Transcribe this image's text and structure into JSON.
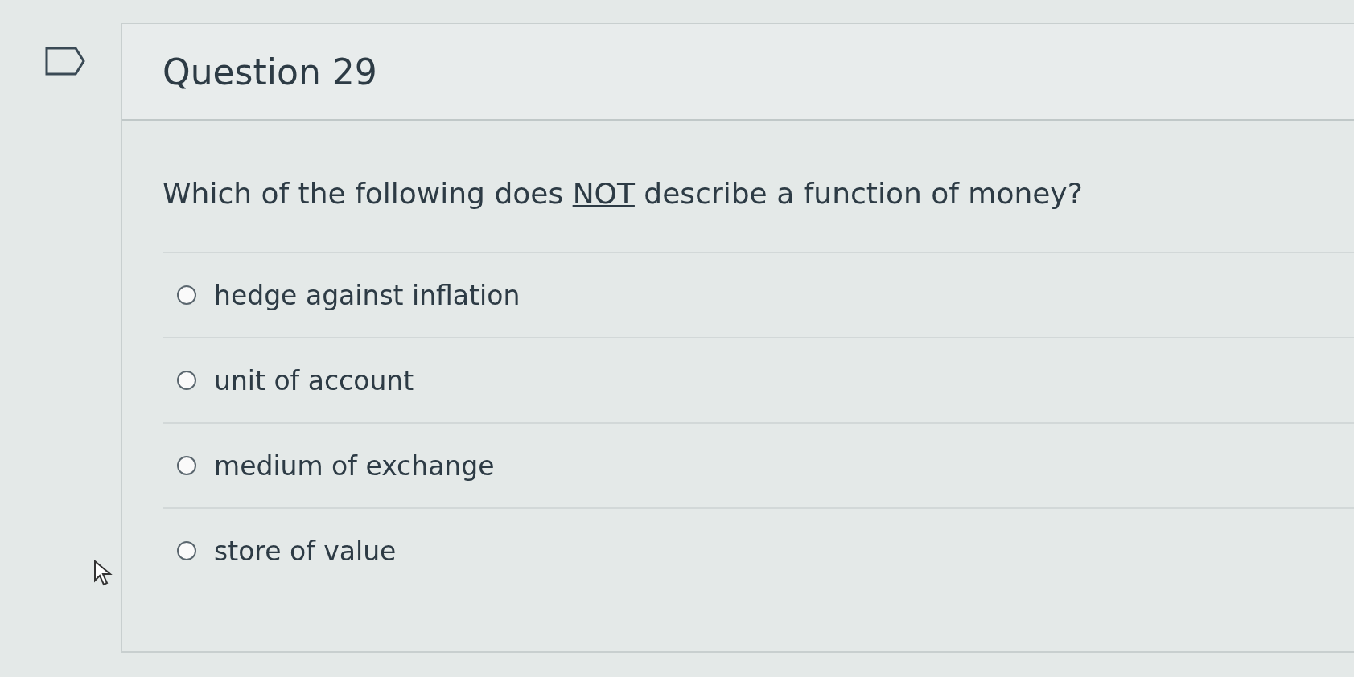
{
  "question": {
    "title": "Question 29",
    "flagged": false
  },
  "prompt": {
    "before": "Which of the following does ",
    "underlined": "NOT",
    "after": " describe a function of money?"
  },
  "options": [
    {
      "label": "hedge against inflation",
      "selected": false
    },
    {
      "label": "unit of account",
      "selected": false
    },
    {
      "label": "medium of exchange",
      "selected": false
    },
    {
      "label": "store of value",
      "selected": false
    }
  ]
}
